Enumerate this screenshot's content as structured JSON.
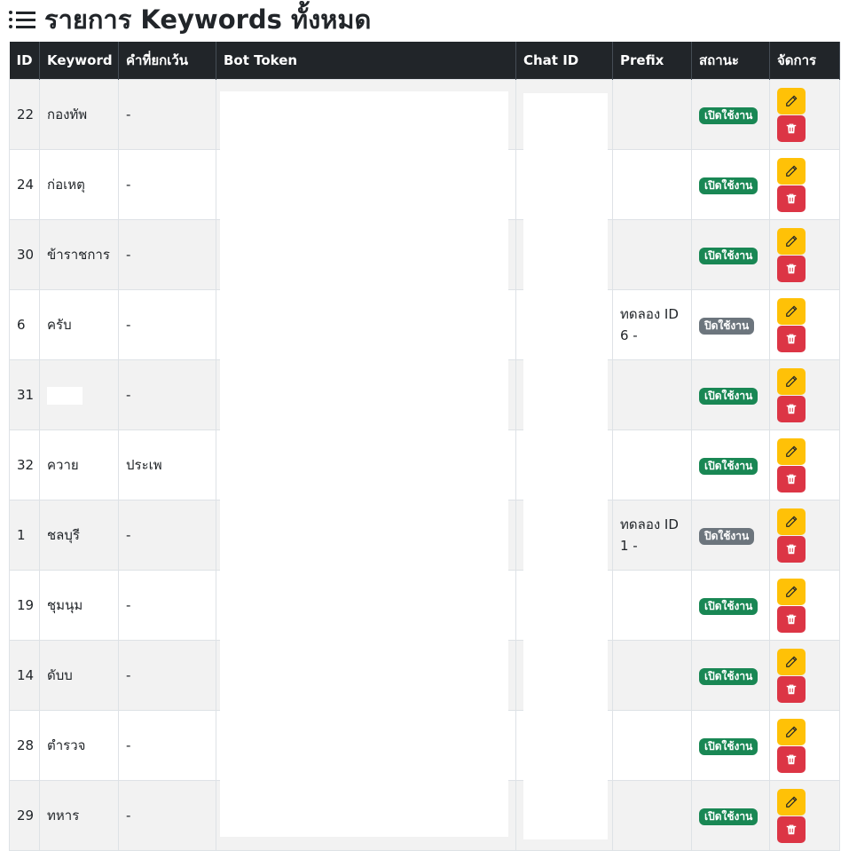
{
  "page": {
    "title": "รายการ Keywords ทั้งหมด",
    "title_icon": "list-icon"
  },
  "table": {
    "headers": [
      "ID",
      "Keyword",
      "คำที่ยกเว้น",
      "Bot Token",
      "Chat ID",
      "Prefix",
      "สถานะ",
      "จัดการ"
    ],
    "rows": [
      {
        "id": "22",
        "keyword": "กองทัพ",
        "exclude": "-",
        "prefix": "",
        "status": "เปิดใช้งาน",
        "active": true
      },
      {
        "id": "24",
        "keyword": "ก่อเหตุ",
        "exclude": "-",
        "prefix": "",
        "status": "เปิดใช้งาน",
        "active": true
      },
      {
        "id": "30",
        "keyword": "ข้าราชการ",
        "exclude": "-",
        "prefix": "",
        "status": "เปิดใช้งาน",
        "active": true
      },
      {
        "id": "6",
        "keyword": "ครับ",
        "exclude": "-",
        "prefix": "ทดลอง ID 6 -",
        "status": "ปิดใช้งาน",
        "active": false
      },
      {
        "id": "31",
        "keyword": "",
        "exclude": "-",
        "prefix": "",
        "status": "เปิดใช้งาน",
        "active": true
      },
      {
        "id": "32",
        "keyword": "ควาย",
        "exclude": "ประเพ",
        "prefix": "",
        "status": "เปิดใช้งาน",
        "active": true
      },
      {
        "id": "1",
        "keyword": "ชลบุรี",
        "exclude": "-",
        "prefix": "ทดลอง ID 1 -",
        "status": "ปิดใช้งาน",
        "active": false
      },
      {
        "id": "19",
        "keyword": "ชุมนุม",
        "exclude": "-",
        "prefix": "",
        "status": "เปิดใช้งาน",
        "active": true
      },
      {
        "id": "14",
        "keyword": "ดับบ",
        "exclude": "-",
        "prefix": "",
        "status": "เปิดใช้งาน",
        "active": true
      },
      {
        "id": "28",
        "keyword": "ตำรวจ",
        "exclude": "-",
        "prefix": "",
        "status": "เปิดใช้งาน",
        "active": true
      },
      {
        "id": "29",
        "keyword": "ทหาร",
        "exclude": "-",
        "prefix": "",
        "status": "เปิดใช้งาน",
        "active": true
      }
    ]
  },
  "colors": {
    "header_bg": "#212529",
    "active_badge": "#198754",
    "inactive_badge": "#6c757d",
    "edit_button": "#ffc107",
    "delete_button": "#dc3545",
    "stripe": "#f2f2f2"
  },
  "icons": {
    "edit": "pencil-icon",
    "delete": "trash-icon"
  }
}
